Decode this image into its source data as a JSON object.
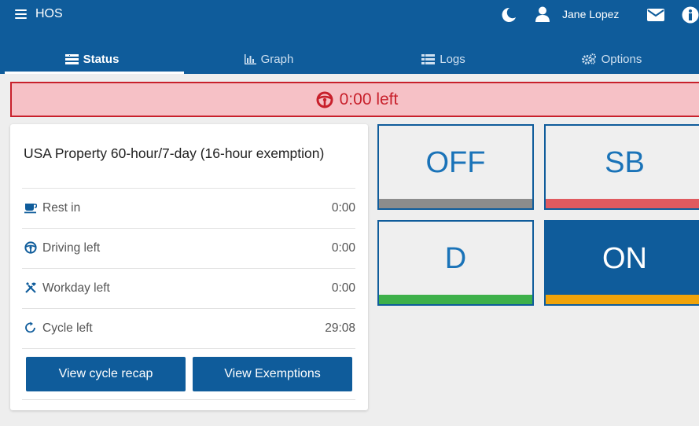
{
  "header": {
    "app_title": "HOS",
    "user_name": "Jane Lopez",
    "icons": [
      "menu-icon",
      "moon-icon",
      "user-icon",
      "mail-icon",
      "info-icon"
    ]
  },
  "tabs": [
    {
      "label": "Status",
      "icon": "status-list-icon",
      "active": true
    },
    {
      "label": "Graph",
      "icon": "bar-chart-icon",
      "active": false
    },
    {
      "label": "Logs",
      "icon": "list-icon",
      "active": false
    },
    {
      "label": "Options",
      "icon": "gears-icon",
      "active": false
    }
  ],
  "alert": {
    "text": "0:00 left",
    "icon": "steering-wheel-icon",
    "color": "#c8202b",
    "background": "#f6c1c6"
  },
  "ruleset": {
    "title": "USA Property 60-hour/7-day (16-hour exemption)",
    "rows": [
      {
        "label": "Rest in",
        "value": "0:00",
        "icon": "coffee-cup-icon"
      },
      {
        "label": "Driving left",
        "value": "0:00",
        "icon": "steering-wheel-icon"
      },
      {
        "label": "Workday left",
        "value": "0:00",
        "icon": "tools-icon"
      },
      {
        "label": "Cycle left",
        "value": "29:08",
        "icon": "cycle-icon"
      }
    ],
    "buttons": {
      "cycle_recap": "View cycle recap",
      "exemptions": "View Exemptions"
    }
  },
  "status_buttons": [
    {
      "label": "OFF",
      "bar_color": "#8c8c8c",
      "active": false
    },
    {
      "label": "SB",
      "bar_color": "#e05a5f",
      "active": false
    },
    {
      "label": "D",
      "bar_color": "#3db04a",
      "active": false
    },
    {
      "label": "ON",
      "bar_color": "#f0a30a",
      "active": true
    }
  ],
  "colors": {
    "primary": "#0f5c9b",
    "background": "#eeeeee"
  }
}
